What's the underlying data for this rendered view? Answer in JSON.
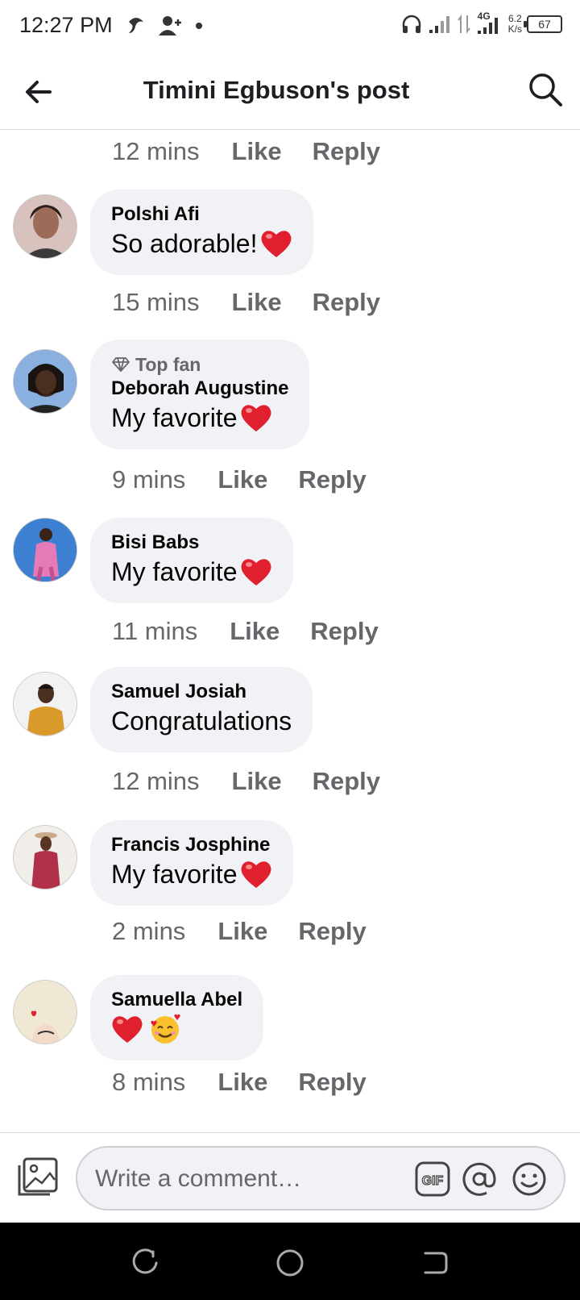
{
  "status_bar": {
    "time": "12:27 PM",
    "network_type": "4G",
    "speed_value": "6.2",
    "speed_unit": "K/s",
    "battery": "67"
  },
  "header": {
    "title": "Timini Egbuson's post"
  },
  "first_meta": {
    "time": "12 mins",
    "like": "Like",
    "reply": "Reply"
  },
  "comments": [
    {
      "name": "Polshi Afi",
      "text": "So adorable!",
      "time": "15 mins",
      "like": "Like",
      "reply": "Reply",
      "avatar_color": "#c9a79b"
    },
    {
      "badge": "Top fan",
      "name": "Deborah Augustine",
      "text": "My favorite ",
      "time": "9 mins",
      "like": "Like",
      "reply": "Reply",
      "avatar_color": "#6b8fc7"
    },
    {
      "name": "Bisi Babs",
      "text": "My favorite ",
      "time": "11 mins",
      "like": "Like",
      "reply": "Reply",
      "avatar_color": "#2f6fbf"
    },
    {
      "name": "Samuel Josiah",
      "text": "Congratulations",
      "time": "12 mins",
      "like": "Like",
      "reply": "Reply",
      "avatar_color": "#d99a2b"
    },
    {
      "name": "Francis Josphine",
      "text": "My favorite ",
      "time": "2 mins",
      "like": "Like",
      "reply": "Reply",
      "avatar_color": "#b0304a"
    },
    {
      "name": "Samuella Abel",
      "text": "",
      "time": "8 mins",
      "like": "Like",
      "reply": "Reply",
      "avatar_color": "#efe6cf"
    }
  ],
  "composer": {
    "placeholder": "Write a comment…"
  },
  "colors": {
    "bubble_bg": "#f0f2f5",
    "meta_text": "#65676b",
    "heart": "#e0202e"
  }
}
